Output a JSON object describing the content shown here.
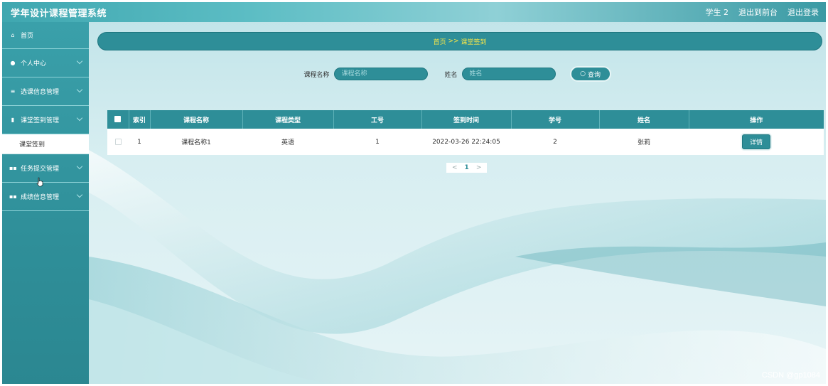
{
  "app": {
    "title": "学年设计课程管理系统"
  },
  "header": {
    "user": "学生 2",
    "back_to_front": "退出到前台",
    "logout": "退出登录"
  },
  "sidebar": {
    "items": [
      {
        "label": "首页",
        "icon": "home-icon"
      },
      {
        "label": "个人中心",
        "icon": "user-icon"
      },
      {
        "label": "选课信息管理",
        "icon": "list-icon"
      },
      {
        "label": "课堂签到管理",
        "icon": "book-icon"
      },
      {
        "label": "课堂签到",
        "icon": ""
      },
      {
        "label": "任务提交管理",
        "icon": "grid-icon"
      },
      {
        "label": "成绩信息管理",
        "icon": "grid-icon"
      }
    ]
  },
  "breadcrumb": {
    "home": "首页",
    "separator": ">>",
    "current": "课堂签到"
  },
  "search": {
    "course_label": "课程名称",
    "course_placeholder": "课程名称",
    "name_label": "姓名",
    "name_placeholder": "姓名",
    "button": "查询"
  },
  "table": {
    "headers": [
      "索引",
      "课程名称",
      "课程类型",
      "工号",
      "签到时间",
      "学号",
      "姓名",
      "操作"
    ],
    "rows": [
      {
        "index": "1",
        "course": "课程名称1",
        "type": "英语",
        "staff_no": "1",
        "time": "2022-03-26 22:24:05",
        "student_no": "2",
        "name": "张莉",
        "action": "详情"
      }
    ]
  },
  "pager": {
    "prev": "<",
    "current": "1",
    "next": ">"
  },
  "watermark": "CSDN @gp1084",
  "colors": {
    "primary": "#2e8e98",
    "breadcrumb_text": "#f3e44a"
  }
}
